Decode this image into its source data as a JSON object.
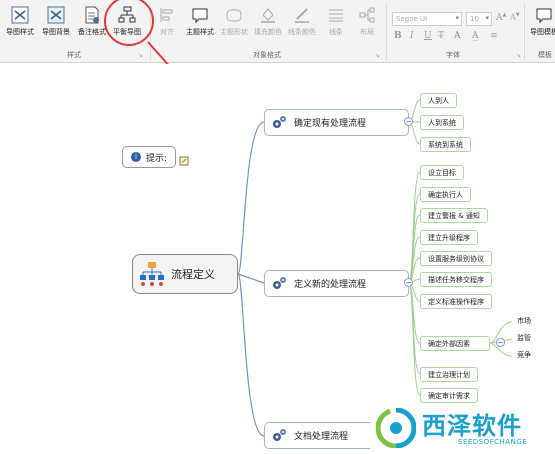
{
  "ribbon": {
    "styles_group": {
      "label": "样式",
      "buttons": [
        "导图样式",
        "导图背景",
        "备注格式",
        "平衡导图"
      ]
    },
    "object_format_group": {
      "label": "对象格式",
      "buttons": [
        "对齐",
        "主题样式",
        "主题形状",
        "填充颜色",
        "线条颜色",
        "线条",
        "布局"
      ]
    },
    "font_group": {
      "label": "字体",
      "font_name": "Segoe UI",
      "font_size": "10",
      "format_buttons": [
        "B",
        "I",
        "U",
        "T̶",
        "A",
        "A̲",
        "≡"
      ]
    },
    "template_group": {
      "label": "模板",
      "button": "导图模板"
    }
  },
  "mindmap": {
    "root": "流程定义",
    "hint": "提示:",
    "branches": [
      {
        "title": "确定现有处理流程",
        "leaves": [
          "人到人",
          "人到系统",
          "系统到系统"
        ]
      },
      {
        "title": "定义新的处理流程",
        "leaves": [
          "设立目标",
          "确定执行人",
          "建立警报 & 通知",
          "建立升级程序",
          "设置服务级别协议",
          "描述任务移交程序",
          "定义标准操作程序",
          "确定外部因素",
          "建立治理计划",
          "确定审计需求"
        ],
        "external_factors": [
          "市场",
          "监管",
          "竞争"
        ]
      },
      {
        "title": "文档处理流程"
      }
    ]
  },
  "watermark": {
    "title": "西泽软件",
    "subtitle": "SEEDSOFCHANGE"
  },
  "colors": {
    "highlight": "#e0393b",
    "connector": "#6b96c4",
    "leaf_border": "#aed7a0",
    "watermark": "#1aa0cf"
  }
}
